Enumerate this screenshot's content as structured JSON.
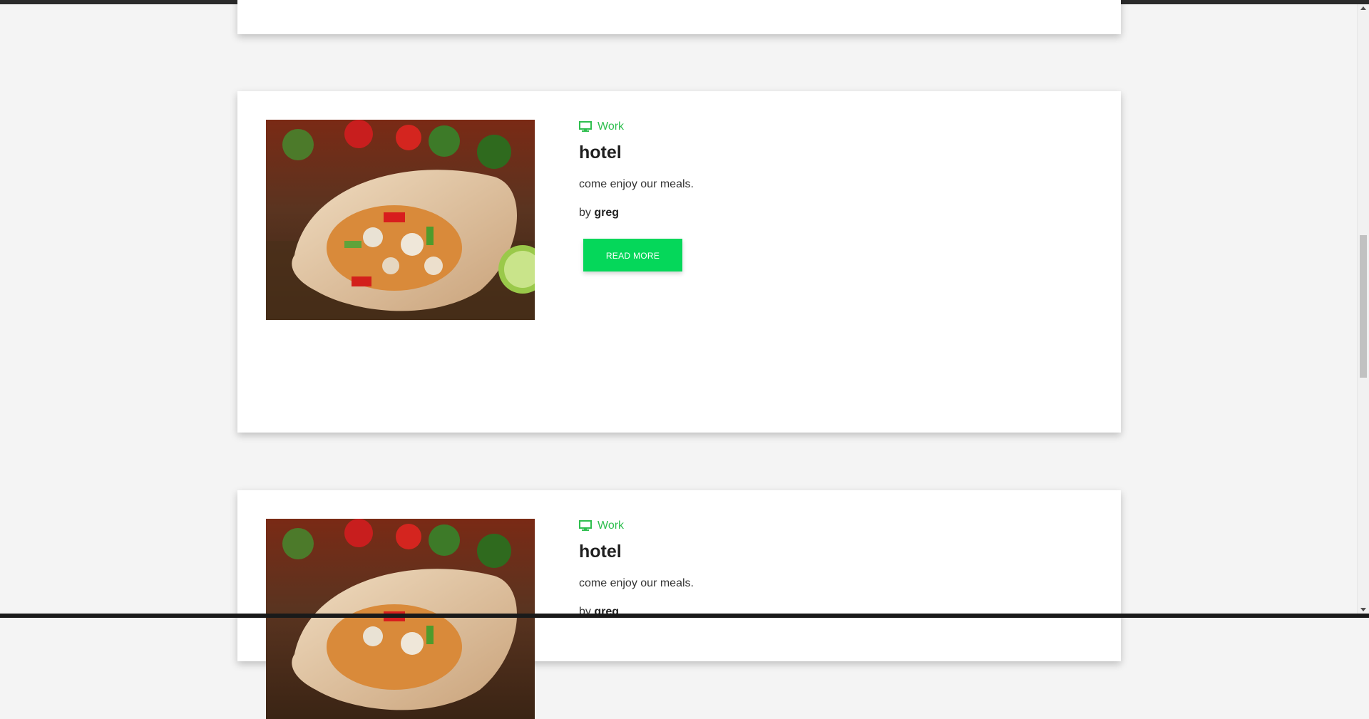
{
  "posts": [
    {
      "category": "Work",
      "title": "hotel",
      "excerpt": "come enjoy our meals.",
      "author_prefix": "by",
      "author": "greg",
      "button_label": "READ MORE"
    },
    {
      "category": "Work",
      "title": "hotel",
      "excerpt": "come enjoy our meals.",
      "author_prefix": "by",
      "author": "greg"
    }
  ],
  "icons": {
    "category": "monitor-icon"
  },
  "colors": {
    "background": "#f4f4f4",
    "card": "#ffffff",
    "accent_green": "#2fbf4f",
    "button_green": "#05d75a",
    "title": "#1f1f1f"
  }
}
